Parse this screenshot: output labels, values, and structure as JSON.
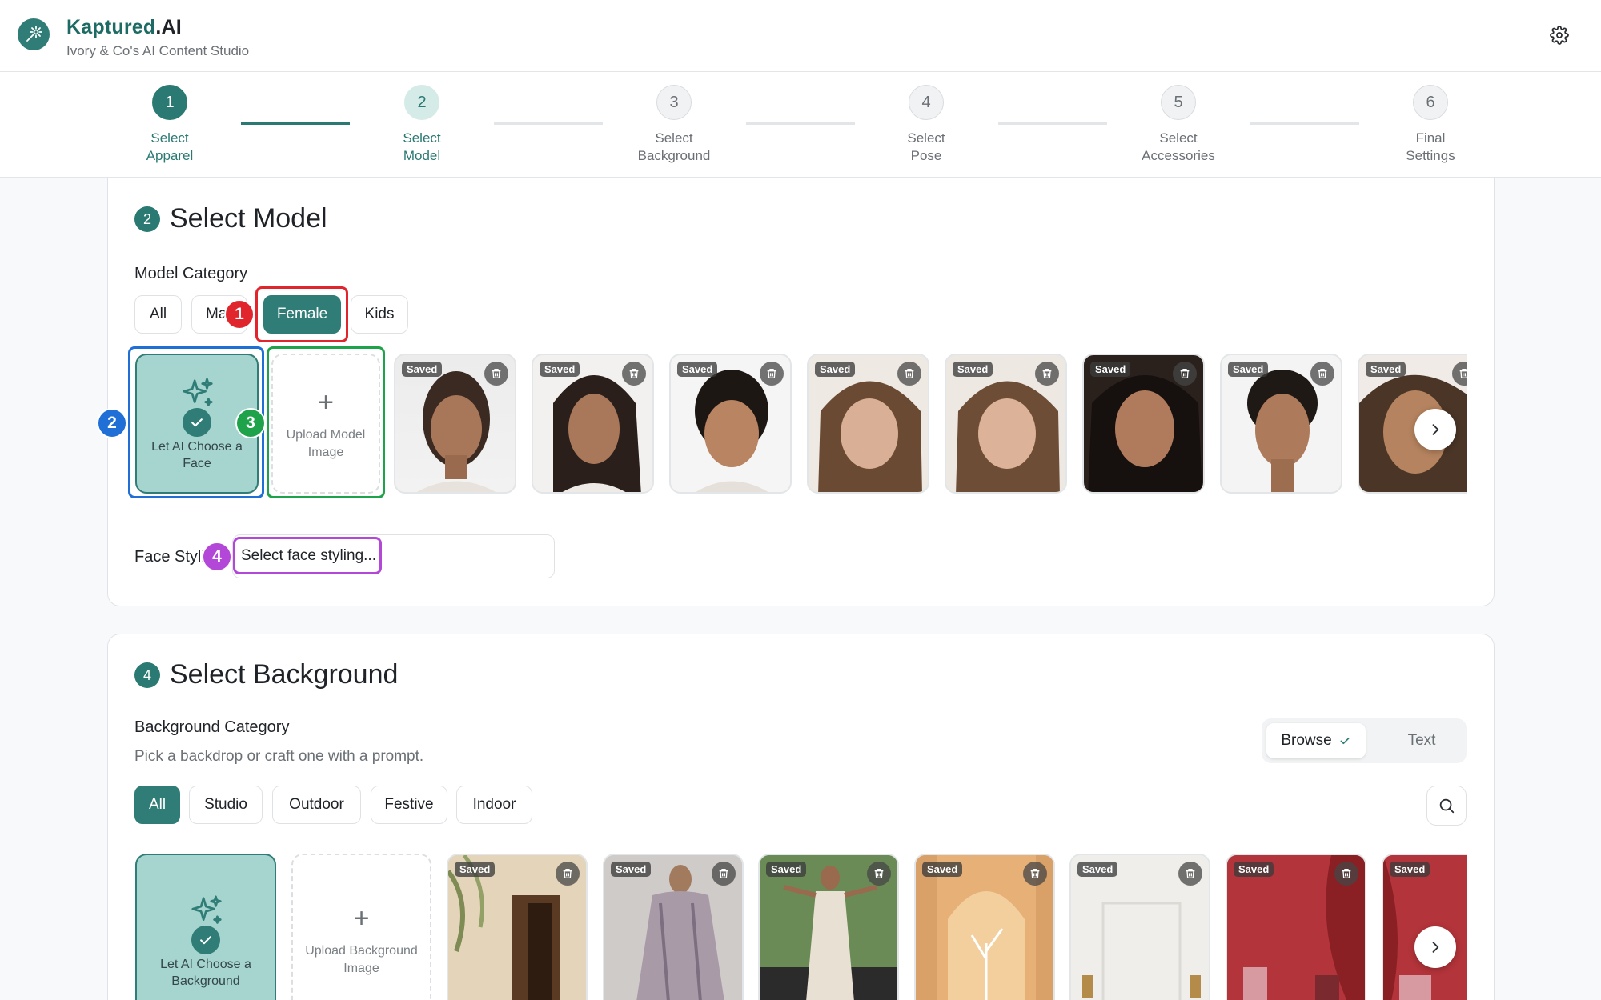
{
  "app": {
    "brand_main": "Kaptured",
    "brand_suffix": ".AI",
    "tagline": "Ivory & Co's AI Content Studio"
  },
  "stepper": [
    {
      "num": "1",
      "line1": "Select",
      "line2": "Apparel"
    },
    {
      "num": "2",
      "line1": "Select",
      "line2": "Model"
    },
    {
      "num": "3",
      "line1": "Select",
      "line2": "Background"
    },
    {
      "num": "4",
      "line1": "Select",
      "line2": "Pose"
    },
    {
      "num": "5",
      "line1": "Select",
      "line2": "Accessories"
    },
    {
      "num": "6",
      "line1": "Final",
      "line2": "Settings"
    }
  ],
  "model_section": {
    "num": "2",
    "title": "Select Model",
    "category_label": "Model Category",
    "categories": [
      "All",
      "Ma",
      "Female",
      "Kids"
    ],
    "selected_category": "Female",
    "ai_tile": {
      "line1": "Let AI Choose a",
      "line2": "Face"
    },
    "upload_tile": {
      "line1": "Upload Model",
      "line2": "Image"
    },
    "saved_badge": "Saved",
    "face_styling_label": "Face Styli",
    "face_styling_placeholder": "Select face styling..."
  },
  "annotations": {
    "one": "1",
    "two": "2",
    "three": "3",
    "four": "4"
  },
  "background_section": {
    "num": "4",
    "title": "Select Background",
    "category_label": "Background Category",
    "hint": "Pick a backdrop or craft one with a prompt.",
    "toggle_browse": "Browse",
    "toggle_text": "Text",
    "categories": [
      "All",
      "Studio",
      "Outdoor",
      "Festive",
      "Indoor"
    ],
    "selected_category": "All",
    "ai_tile": {
      "line1": "Let AI Choose a",
      "line2": "Background"
    },
    "upload_tile": {
      "line1": "Upload Background",
      "line2": "Image"
    },
    "saved_badge": "Saved"
  },
  "icons": {
    "logo": "wand-sparkle-icon",
    "settings": "gear-icon",
    "sparkle": "sparkles-icon",
    "check": "check-icon",
    "delete": "trash-icon",
    "next": "chevron-right-icon",
    "search": "search-icon"
  },
  "colors": {
    "brand": "#2f7d76",
    "brand_light": "#a6d4cf",
    "annot_red": "#e0262c",
    "annot_blue": "#1f6fd6",
    "annot_green": "#1fa34a",
    "annot_purple": "#b348d8"
  }
}
